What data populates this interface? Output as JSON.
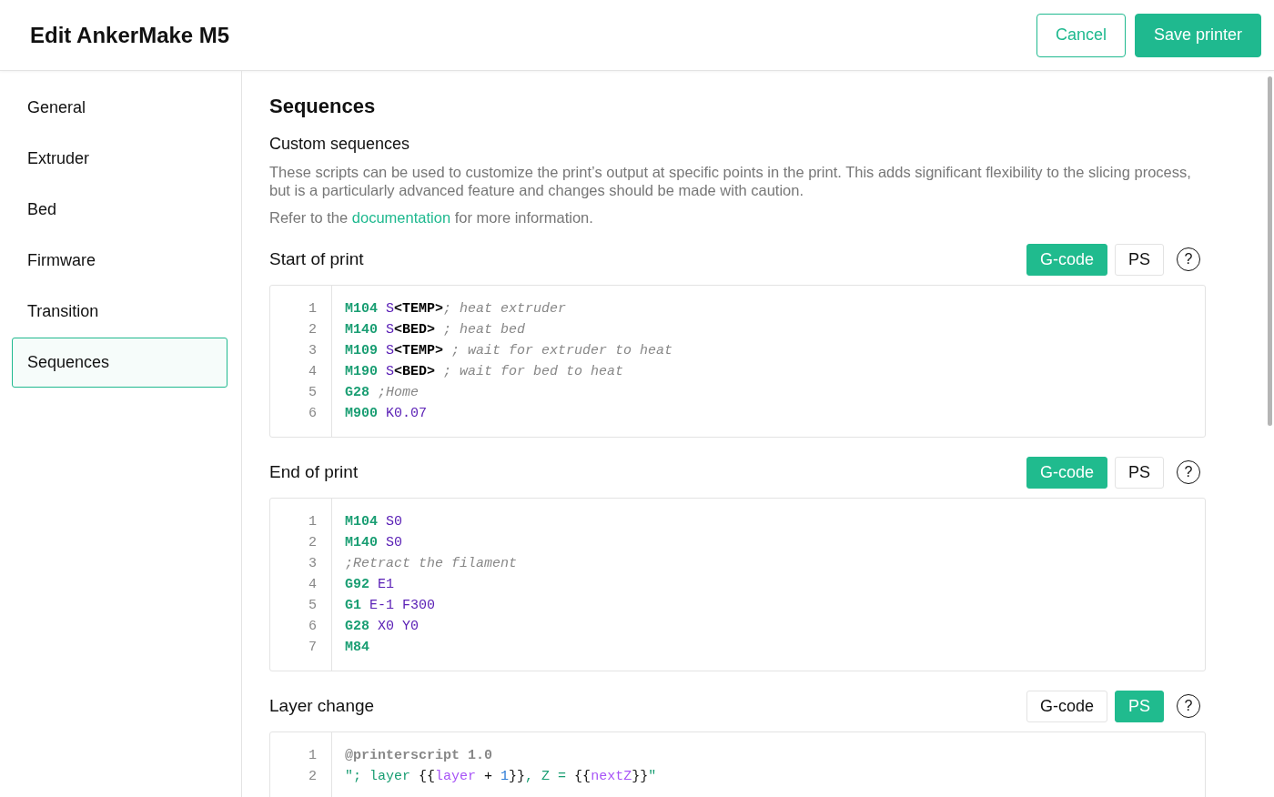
{
  "header": {
    "title": "Edit AnkerMake M5",
    "cancel": "Cancel",
    "save": "Save printer"
  },
  "sidebar": {
    "items": [
      {
        "label": "General",
        "selected": false
      },
      {
        "label": "Extruder",
        "selected": false
      },
      {
        "label": "Bed",
        "selected": false
      },
      {
        "label": "Firmware",
        "selected": false
      },
      {
        "label": "Transition",
        "selected": false
      },
      {
        "label": "Sequences",
        "selected": true
      }
    ]
  },
  "content": {
    "title": "Sequences",
    "subtitle": "Custom sequences",
    "description": "These scripts can be used to customize the print’s output at specific points in the print. This adds significant flexibility to the slicing process, but is a particularly advanced feature and changes should be made with caution.",
    "refer_before": "Refer to the ",
    "refer_link": "documentation",
    "refer_after": " for more information.",
    "sections": [
      {
        "title": "Start of print",
        "modes": [
          {
            "label": "G-code",
            "selected": true
          },
          {
            "label": "PS",
            "selected": false
          }
        ],
        "help": "?",
        "lines": [
          {
            "number": "1",
            "tokens": [
              {
                "kind": "keyword",
                "text": "M104"
              },
              {
                "kind": "param",
                "text": " S"
              },
              {
                "kind": "var",
                "text": "<TEMP>"
              },
              {
                "kind": "comment",
                "text": "; heat extruder"
              }
            ]
          },
          {
            "number": "2",
            "tokens": [
              {
                "kind": "keyword",
                "text": "M140"
              },
              {
                "kind": "param",
                "text": " S"
              },
              {
                "kind": "var",
                "text": "<BED>"
              },
              {
                "kind": "comment",
                "text": " ; heat bed"
              }
            ]
          },
          {
            "number": "3",
            "tokens": [
              {
                "kind": "keyword",
                "text": "M109"
              },
              {
                "kind": "param",
                "text": " S"
              },
              {
                "kind": "var",
                "text": "<TEMP>"
              },
              {
                "kind": "comment",
                "text": " ; wait for extruder to heat"
              }
            ]
          },
          {
            "number": "4",
            "tokens": [
              {
                "kind": "keyword",
                "text": "M190"
              },
              {
                "kind": "param",
                "text": " S"
              },
              {
                "kind": "var",
                "text": "<BED>"
              },
              {
                "kind": "comment",
                "text": " ; wait for bed to heat"
              }
            ]
          },
          {
            "number": "5",
            "tokens": [
              {
                "kind": "keyword",
                "text": "G28"
              },
              {
                "kind": "comment",
                "text": " ;Home"
              }
            ]
          },
          {
            "number": "6",
            "tokens": [
              {
                "kind": "keyword",
                "text": "M900"
              },
              {
                "kind": "param",
                "text": " K0.07"
              }
            ]
          }
        ]
      },
      {
        "title": "End of print",
        "modes": [
          {
            "label": "G-code",
            "selected": true
          },
          {
            "label": "PS",
            "selected": false
          }
        ],
        "help": "?",
        "lines": [
          {
            "number": "1",
            "tokens": [
              {
                "kind": "keyword",
                "text": "M104"
              },
              {
                "kind": "param",
                "text": " S0"
              }
            ]
          },
          {
            "number": "2",
            "tokens": [
              {
                "kind": "keyword",
                "text": "M140"
              },
              {
                "kind": "param",
                "text": " S0"
              }
            ]
          },
          {
            "number": "3",
            "tokens": [
              {
                "kind": "comment",
                "text": ";Retract the filament"
              }
            ]
          },
          {
            "number": "4",
            "tokens": [
              {
                "kind": "keyword",
                "text": "G92"
              },
              {
                "kind": "param",
                "text": " E1"
              }
            ]
          },
          {
            "number": "5",
            "tokens": [
              {
                "kind": "keyword",
                "text": "G1"
              },
              {
                "kind": "param",
                "text": " E-1 F300"
              }
            ]
          },
          {
            "number": "6",
            "tokens": [
              {
                "kind": "keyword",
                "text": "G28"
              },
              {
                "kind": "param",
                "text": " X0 Y0"
              }
            ]
          },
          {
            "number": "7",
            "tokens": [
              {
                "kind": "keyword",
                "text": "M84"
              }
            ]
          }
        ]
      },
      {
        "title": "Layer change",
        "modes": [
          {
            "label": "G-code",
            "selected": false
          },
          {
            "label": "PS",
            "selected": true
          }
        ],
        "help": "?",
        "lines": [
          {
            "number": "1",
            "tokens": [
              {
                "kind": "directive",
                "text": "@printerscript 1.0"
              }
            ]
          },
          {
            "number": "2",
            "tokens": [
              {
                "kind": "string",
                "text": "\"; layer "
              },
              {
                "kind": "plain",
                "text": "{{"
              },
              {
                "kind": "ident",
                "text": "layer"
              },
              {
                "kind": "plain",
                "text": " + "
              },
              {
                "kind": "number",
                "text": "1"
              },
              {
                "kind": "plain",
                "text": "}}"
              },
              {
                "kind": "string",
                "text": ", Z = "
              },
              {
                "kind": "plain",
                "text": "{{"
              },
              {
                "kind": "ident",
                "text": "nextZ"
              },
              {
                "kind": "plain",
                "text": "}}"
              },
              {
                "kind": "string",
                "text": "\""
              }
            ]
          }
        ]
      }
    ]
  }
}
